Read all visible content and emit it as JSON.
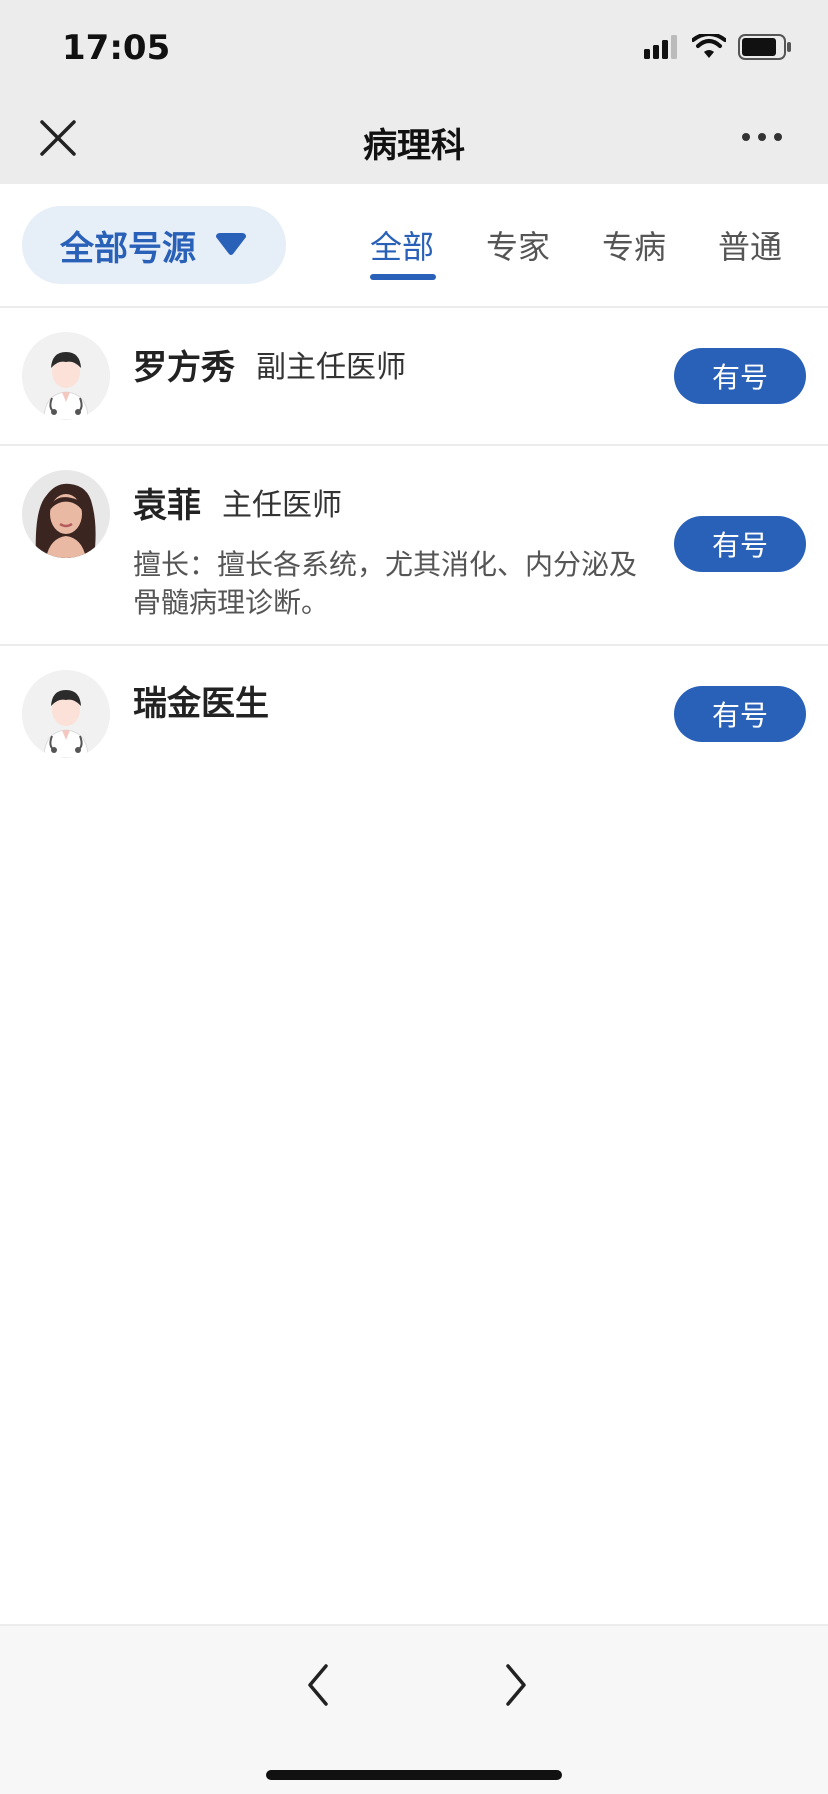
{
  "status_bar": {
    "time": "17:05"
  },
  "header": {
    "title": "病理科"
  },
  "filter": {
    "source_label": "全部号源",
    "tabs": [
      {
        "label": "全部",
        "active": true
      },
      {
        "label": "专家",
        "active": false
      },
      {
        "label": "专病",
        "active": false
      },
      {
        "label": "普通",
        "active": false
      }
    ]
  },
  "doctors": [
    {
      "name": "罗方秀",
      "title": "副主任医师",
      "specialty": "",
      "button": "有号",
      "avatar": "default-doctor-avatar"
    },
    {
      "name": "袁菲",
      "title": "主任医师",
      "specialty": "擅长：擅长各系统，尤其消化、内分泌及骨髓病理诊断。",
      "button": "有号",
      "avatar": "doctor-photo"
    },
    {
      "name": "瑞金医生",
      "title": "",
      "specialty": "",
      "button": "有号",
      "avatar": "default-doctor-avatar"
    }
  ],
  "colors": {
    "accent": "#2960b8",
    "header_bg": "#ececec",
    "pill_bg": "#e6eef8"
  }
}
